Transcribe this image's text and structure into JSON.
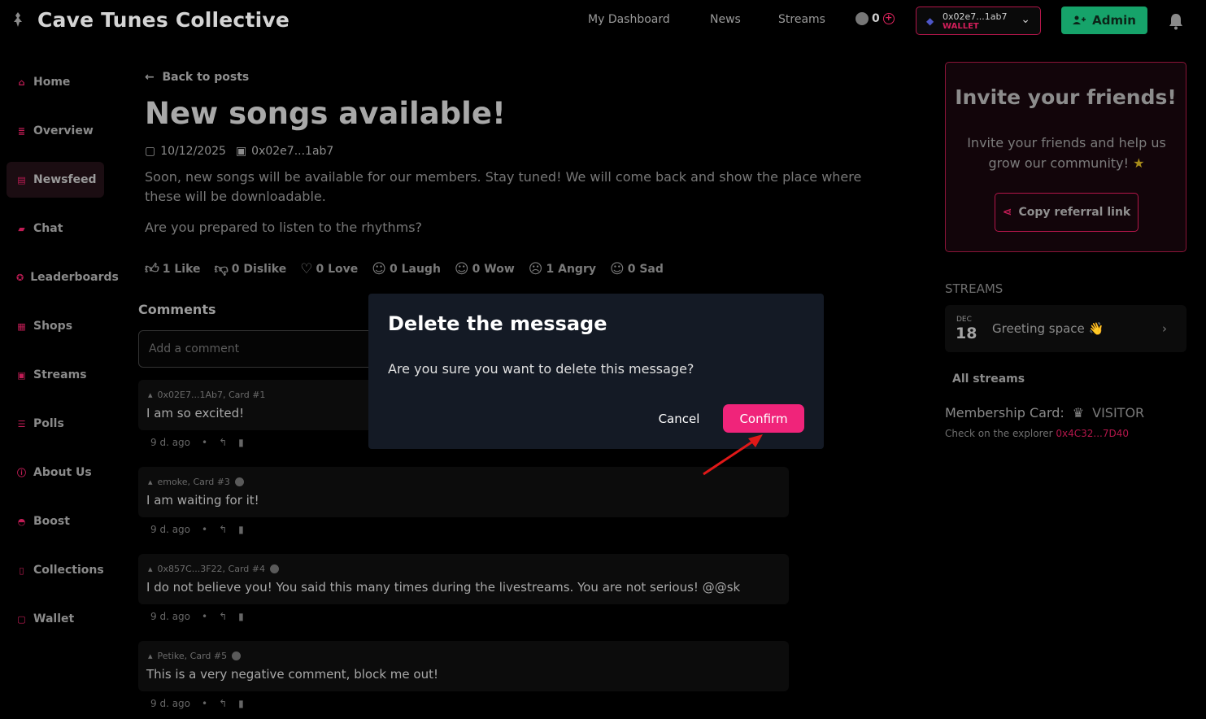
{
  "app": {
    "title": "Cave Tunes Collective"
  },
  "nav": {
    "dashboard": "My Dashboard",
    "news": "News",
    "streams": "Streams"
  },
  "points": "0",
  "wallet": {
    "address": "0x02e7...1ab7",
    "label": "WALLET"
  },
  "admin": {
    "label": "Admin"
  },
  "sidebar": {
    "items": [
      {
        "label": "Home",
        "icon": "home-icon"
      },
      {
        "label": "Overview",
        "icon": "overview-icon"
      },
      {
        "label": "Newsfeed",
        "icon": "newsfeed-icon",
        "active": true
      },
      {
        "label": "Chat",
        "icon": "chat-icon"
      },
      {
        "label": "Leaderboards",
        "icon": "leaderboards-icon"
      },
      {
        "label": "Shops",
        "icon": "shop-icon"
      },
      {
        "label": "Streams",
        "icon": "calendar-icon"
      },
      {
        "label": "Polls",
        "icon": "polls-icon"
      },
      {
        "label": "About Us",
        "icon": "info-icon"
      },
      {
        "label": "Boost",
        "icon": "boost-icon"
      },
      {
        "label": "Collections",
        "icon": "collections-icon"
      },
      {
        "label": "Wallet",
        "icon": "wallet-icon"
      }
    ]
  },
  "post": {
    "back": "Back to posts",
    "title": "New songs available!",
    "date": "10/12/2025",
    "author": "0x02e7...1ab7",
    "body": "Soon, new songs will be available for our members. Stay tuned! We will come back and show the place where these will be downloadable.",
    "question": "Are you prepared to listen to the rhythms?",
    "reactions": [
      {
        "label": "1 Like",
        "icon": "thumbs-up-icon"
      },
      {
        "label": "0 Dislike",
        "icon": "thumbs-down-icon"
      },
      {
        "label": "0 Love",
        "icon": "heart-icon"
      },
      {
        "label": "0 Laugh",
        "icon": "laugh-icon"
      },
      {
        "label": "0 Wow",
        "icon": "wow-icon"
      },
      {
        "label": "1 Angry",
        "icon": "angry-icon"
      },
      {
        "label": "0 Sad",
        "icon": "sad-icon"
      }
    ]
  },
  "comments": {
    "title": "Comments",
    "placeholder": "Add a comment",
    "items": [
      {
        "author": "0x02E7...1Ab7, Card #1",
        "text": "I am so excited!",
        "time": "9 d. ago",
        "badge": false
      },
      {
        "author": "emoke, Card #3",
        "text": "I am waiting for it!",
        "time": "9 d. ago",
        "badge": true
      },
      {
        "author": "0x857C...3F22, Card #4",
        "text": "I do not believe you! You said this many times during the livestreams. You are not serious! @@sk",
        "time": "9 d. ago",
        "badge": true
      },
      {
        "author": "Petike, Card #5",
        "text": "This is a very negative comment, block me out!",
        "time": "9 d. ago",
        "badge": true
      }
    ]
  },
  "invite": {
    "title": "Invite your friends!",
    "text": "Invite your friends and help us grow our community!",
    "button": "Copy referral link"
  },
  "streams_panel": {
    "heading": "STREAMS",
    "month": "DEC",
    "day": "18",
    "name": "Greeting space 👋",
    "all": "All streams"
  },
  "membership": {
    "label": "Membership Card:",
    "tier": "VISITOR",
    "explorer_text": "Check on the explorer",
    "explorer_link": "0x4C32...7D40"
  },
  "modal": {
    "title": "Delete the message",
    "text": "Are you sure you want to delete this message?",
    "cancel": "Cancel",
    "confirm": "Confirm"
  },
  "colors": {
    "accent": "#f0247a",
    "admin": "#16a36a",
    "border_accent": "#b3164a"
  }
}
